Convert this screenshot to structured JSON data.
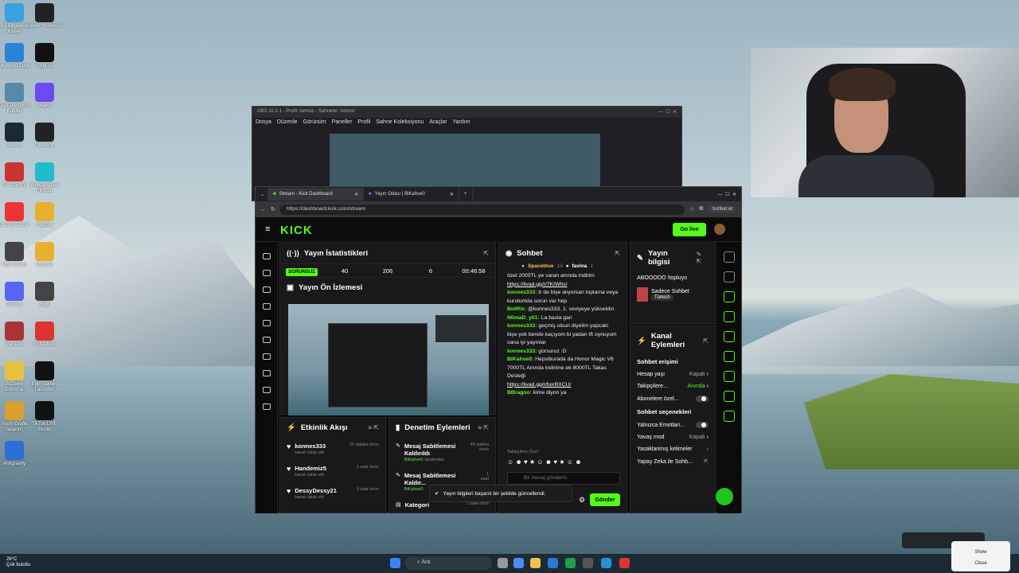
{
  "colors": {
    "accent": "#53fc18",
    "bg": "#0e0e10",
    "panel": "#19191c"
  },
  "desktop": {
    "icons": [
      "Bu Bilgisayar Kişisel",
      "Görev Yöneticisi",
      "Microsoft Edge",
      "CapCut",
      "Geri Dönüşüm Kutusu",
      "Wand",
      "Steam",
      "Overwolf",
      "GT Control",
      "Wondershare Filmora",
      "CASIO Center",
      "Capcut",
      "OBS Studio",
      "Oyunlar",
      "Discord",
      "Bilgi",
      "Valorant",
      "Riot Client",
      "AIDA64 Extreme",
      "Epic Games Launcher",
      "Yayın Grafik tasarım",
      "TikTok LIVE Studio",
      "Antigravity"
    ]
  },
  "obs": {
    "title": "OBS 32.2.1 - Profil: İsimsiz - Sahneler: İsimsiz",
    "menu": [
      "Dosya",
      "Düzenle",
      "Görünüm",
      "Paneller",
      "Profil",
      "Sahne Koleksiyonu",
      "Araçlar",
      "Yardım"
    ]
  },
  "browser": {
    "tabs": [
      {
        "label": "Stream - Kick Dashboard"
      },
      {
        "label": "Yayın Odası | BiKahve0"
      }
    ],
    "url": "https://dashboard.kick.com/stream",
    "profile": "Sohbet et"
  },
  "kick": {
    "logo": "KICK",
    "go_live": "Go live",
    "stats": {
      "title": "Yayın İstatistikleri",
      "status": "SORUNSUZ",
      "viewers": "40",
      "followers": "206",
      "subs": "6",
      "time": "00:46:58"
    },
    "preview_title": "Yayın Ön İzlemesi",
    "activity": {
      "title": "Etkinlik Akışı",
      "items": [
        {
          "name": "konnes333",
          "desc": "kanalı takip etti",
          "time": "26 dakika önce"
        },
        {
          "name": "Handemiz5",
          "desc": "kanalı takip etti",
          "time": "1 saat önce"
        },
        {
          "name": "DessyDessy21",
          "desc": "kanalı takip etti",
          "time": "1 saat önce"
        }
      ]
    },
    "mod": {
      "title": "Denetim Eylemleri",
      "items": [
        {
          "name": "Mesaj Sabitlemesi Kaldırıldı",
          "by": "BiKahve0",
          "suffix": "tarafından",
          "time": "49 dakika önce"
        },
        {
          "name": "Mesaj Sabitlemesi Kaldır...",
          "by": "BiKahve0",
          "suffix": "",
          "time": "1 saat"
        },
        {
          "name": "Kategori",
          "by": "",
          "suffix": "",
          "time": "1 saat önce"
        }
      ]
    },
    "chat": {
      "title": "Sohbet",
      "pinned": [
        "Spaceblue",
        "13",
        "favina",
        "1"
      ],
      "messages": [
        {
          "u": "",
          "t": "özel 2000TL ye varan anında indirim"
        },
        {
          "u": "",
          "t": "https://livad.gg/r/7KIWhs/",
          "link": true
        },
        {
          "u": "konnes333:",
          "t": "tr de bişe alıyorsan toplama veya kurulumda sorun var hep"
        },
        {
          "u": "BotRix:",
          "t": "@konnes333, 1. seviyeye yükseldin."
        },
        {
          "u": "N0maD_y01:",
          "t": "La basla gari"
        },
        {
          "u": "konnes333:",
          "t": "geçmiş olsun diyelim yapcaki bişe yok bende kaçıyom bi yadan tft oynuyom sana iyi yayınlar"
        },
        {
          "u": "konnes333:",
          "t": "gorsuruz :D"
        },
        {
          "u": "BiKahve0:",
          "t": "Hepsiburada da Honor Magic V6 7000TL Anında indirime ek 8000TL Takas Desteği"
        },
        {
          "u": "",
          "t": "https://livad.gg/r/borBXCU/",
          "link": true
        },
        {
          "u": "BBragoo:",
          "t": "kime diyon ya"
        }
      ],
      "followers_only": "Takipçilere Özel",
      "placeholder": "Bir mesaj gönderin",
      "send": "Gönder"
    },
    "toast": "Yayın bilgileri başarılı bir şekilde güncellendi.",
    "info": {
      "title": "Yayın bilgisi",
      "stream_title": "ABOOOOO !topluyo",
      "category": "Sadece Sohbet",
      "lang": "Türkish"
    },
    "channel": {
      "title": "Kanal Eylemleri",
      "access": "Sohbet erişimi",
      "rows": [
        {
          "k": "Hesap yaşı",
          "v": "Kapalı"
        },
        {
          "k": "Takipçilere...",
          "v": "Anında"
        },
        {
          "k": "Abonelere özel...",
          "v": ""
        }
      ],
      "settings": "Sohbet seçenekleri",
      "rows2": [
        {
          "k": "Yalnızca Emotlari...",
          "v": ""
        },
        {
          "k": "Yavaş mod",
          "v": "Kapalı"
        },
        {
          "k": "Yasaklanmış kelimeler",
          "v": ""
        },
        {
          "k": "Yapay Zeka ile Sohb...",
          "v": ""
        }
      ]
    }
  },
  "taskbar": {
    "weather_temp": "26°C",
    "weather_desc": "Çok bulutlu",
    "search": "Ara"
  },
  "popup": {
    "show": "Show",
    "close": "Close"
  }
}
